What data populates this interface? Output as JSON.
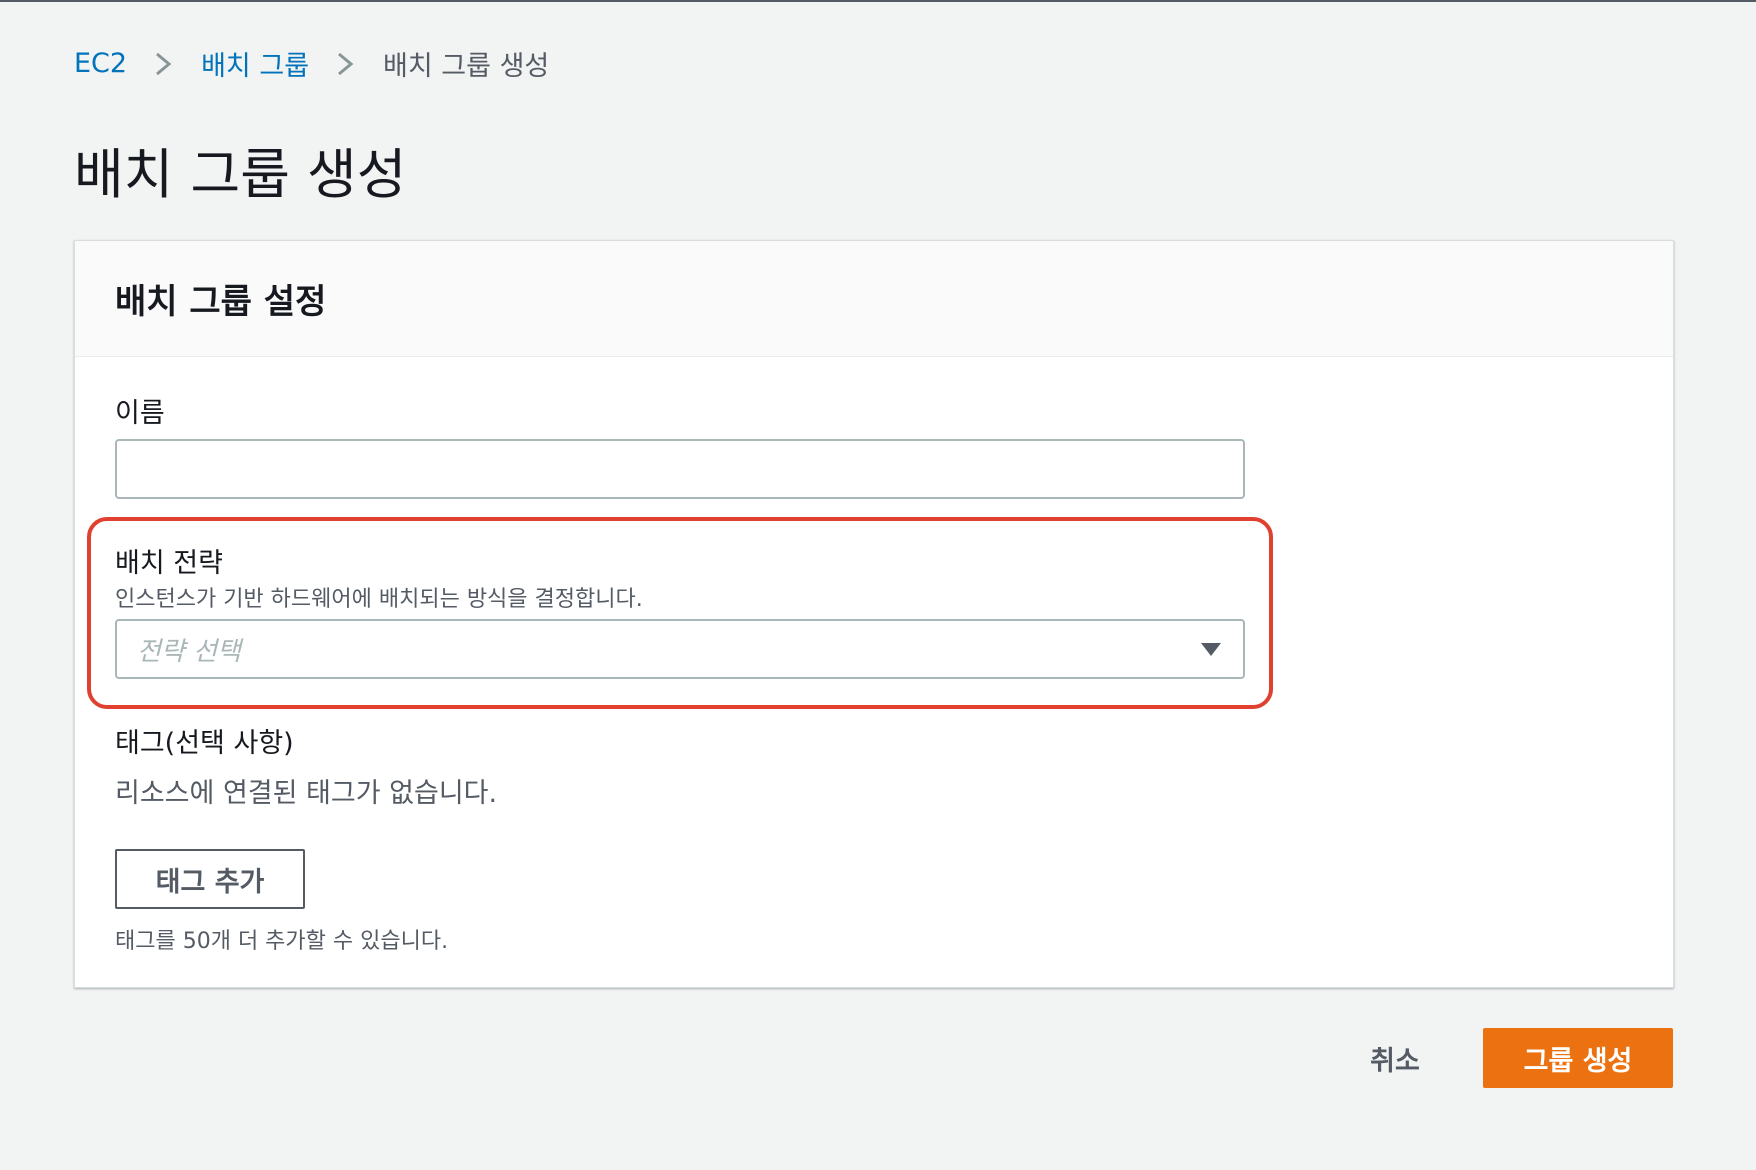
{
  "breadcrumb": {
    "items": [
      "EC2",
      "배치 그룹"
    ],
    "current": "배치 그룹 생성"
  },
  "page": {
    "title": "배치 그룹 생성"
  },
  "panel": {
    "title": "배치 그룹 설정",
    "name": {
      "label": "이름",
      "value": ""
    },
    "strategy": {
      "label": "배치 전략",
      "description": "인스턴스가 기반 하드웨어에 배치되는 방식을 결정합니다.",
      "placeholder": "전략 선택"
    },
    "tags": {
      "label": "태그(선택 사항)",
      "empty_text": "리소스에 연결된 태그가 없습니다.",
      "add_label": "태그 추가",
      "limit_text": "태그를 50개 더 추가할 수 있습니다."
    }
  },
  "actions": {
    "cancel_label": "취소",
    "create_label": "그룹 생성"
  },
  "colors": {
    "accent": "#ec7211",
    "link": "#0073bb",
    "highlight": "#e0402f"
  }
}
